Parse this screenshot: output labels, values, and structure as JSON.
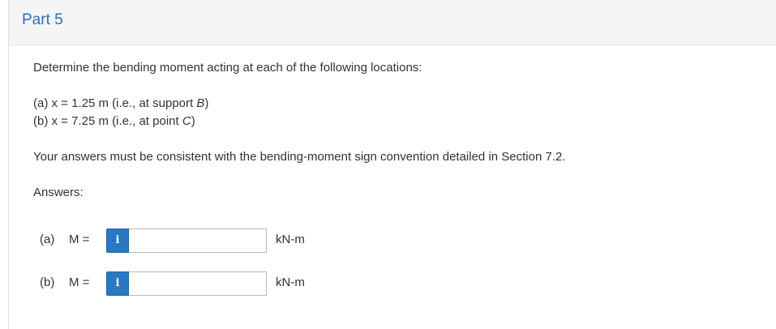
{
  "header": {
    "part_title": "Part 5"
  },
  "question": {
    "prompt": "Determine the bending moment acting at each of the following locations:",
    "locations": [
      {
        "prefix": "(a) x = 1.25 m (i.e., at support ",
        "point": "B",
        "suffix": ")"
      },
      {
        "prefix": "(b) x = 7.25 m (i.e., at point ",
        "point": "C",
        "suffix": ")"
      }
    ],
    "convention_note": "Your answers must be consistent with the bending-moment sign convention detailed in Section 7.2.",
    "answers_label": "Answers:"
  },
  "answers": [
    {
      "label": "(a)",
      "variable": "M =",
      "info_icon": "i",
      "value": "",
      "unit": "kN-m"
    },
    {
      "label": "(b)",
      "variable": "M =",
      "info_icon": "i",
      "value": "",
      "unit": "kN-m"
    }
  ],
  "colors": {
    "title": "#2d6fb5",
    "info_button": "#2a78c3",
    "header_bg": "#f5f5f5"
  }
}
